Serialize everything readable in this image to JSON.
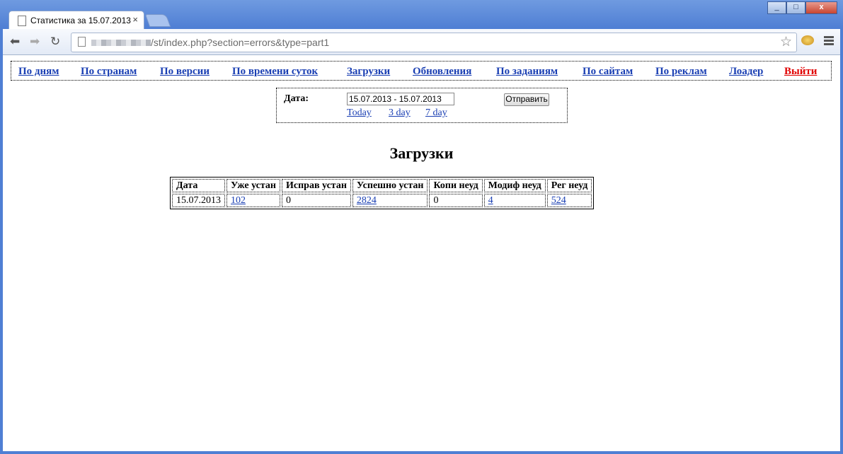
{
  "browser": {
    "tab_title": "Статистика за 15.07.2013",
    "tab_close": "×",
    "url_path": "/st/index.php?section=errors&type=part1",
    "window_buttons": {
      "minimize": "_",
      "maximize": "□",
      "close": "x"
    }
  },
  "nav": {
    "items": [
      "По дням",
      "По странам",
      "По версии",
      "По времени суток",
      "Загрузки",
      "Обновления",
      "По заданиям",
      "По сайтам",
      "По реклам",
      "Лоадер"
    ],
    "exit": "Выйти"
  },
  "date_form": {
    "label": "Дата:",
    "value": "15.07.2013 - 15.07.2013",
    "submit": "Отправить",
    "quick_links": [
      "Today",
      "3 day",
      "7 day"
    ]
  },
  "heading": "Загрузки",
  "table": {
    "headers": [
      "Дата",
      "Уже устан",
      "Исправ устан",
      "Успешно устан",
      "Копи неуд",
      "Модиф неуд",
      "Рег неуд"
    ],
    "row": {
      "date": "15.07.2013",
      "already": "102",
      "fixed": "0",
      "success": "2824",
      "copy_fail": "0",
      "modif_fail": "4",
      "reg_fail": "524"
    }
  },
  "colors": {
    "link": "#1a3fb3",
    "exit": "#e00000",
    "chrome": "#4f7fd4"
  }
}
